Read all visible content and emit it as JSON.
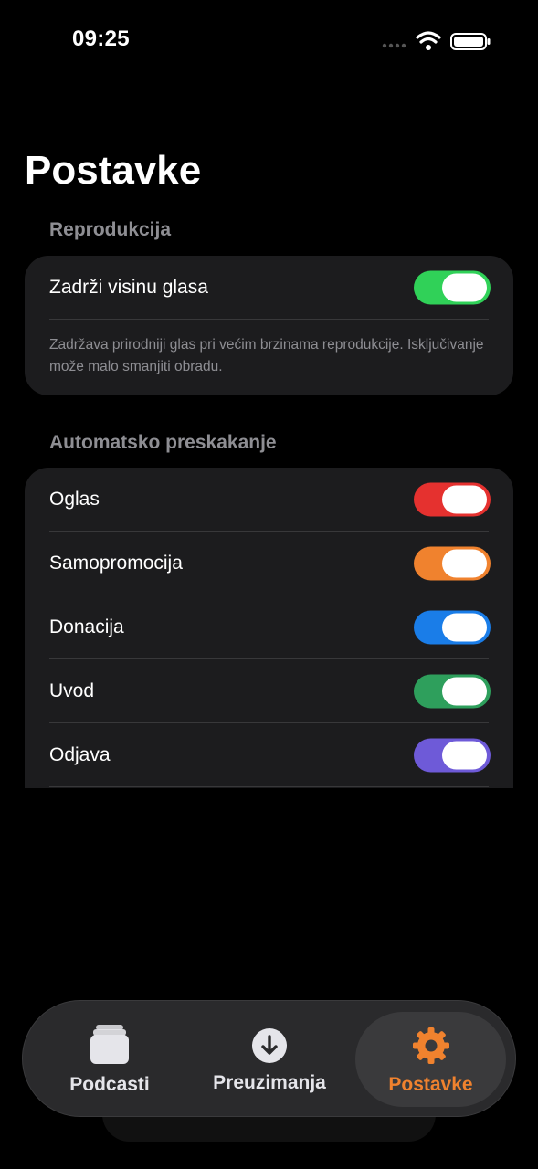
{
  "status": {
    "time": "09:25"
  },
  "page": {
    "title": "Postavke"
  },
  "sections": [
    {
      "header": "Reprodukcija",
      "rows": [
        {
          "label": "Zadrži visinu glasa",
          "on": true,
          "color": "#30d158"
        }
      ],
      "footnote": "Zadržava prirodniji glas pri većim brzinama reprodukcije. Isključivanje može malo smanjiti obradu."
    },
    {
      "header": "Automatsko preskakanje",
      "rows": [
        {
          "label": "Oglas",
          "on": true,
          "color": "#e5312f"
        },
        {
          "label": "Samopromocija",
          "on": true,
          "color": "#f0822e"
        },
        {
          "label": "Donacija",
          "on": true,
          "color": "#1a7de8"
        },
        {
          "label": "Uvod",
          "on": true,
          "color": "#2e9f5c"
        },
        {
          "label": "Odjava",
          "on": true,
          "color": "#6e5ad8"
        }
      ]
    }
  ],
  "tabbar": {
    "tabs": [
      {
        "label": "Podcasti",
        "icon": "podcasts-stack-icon",
        "active": false
      },
      {
        "label": "Preuzimanja",
        "icon": "download-icon",
        "active": false
      },
      {
        "label": "Postavke",
        "icon": "gear-icon",
        "active": true
      }
    ],
    "accent": "#f0822e"
  }
}
